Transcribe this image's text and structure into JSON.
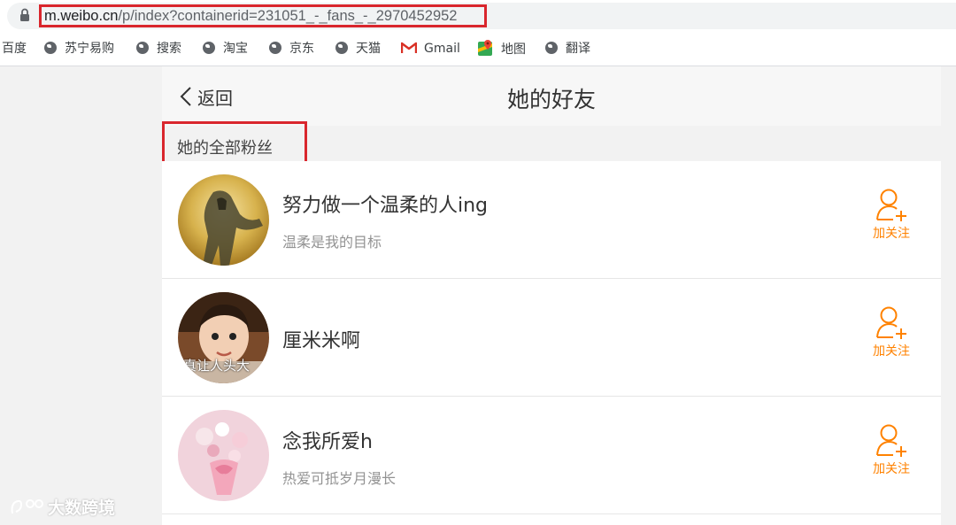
{
  "browser": {
    "url_host": "m.weibo.cn",
    "url_path": "/p/index?containerid=231051_-_fans_-_2970452952",
    "bookmarks": [
      {
        "label": "百度",
        "icon": "none"
      },
      {
        "label": "苏宁易购",
        "icon": "globe-icon"
      },
      {
        "label": "搜索",
        "icon": "globe-icon"
      },
      {
        "label": "淘宝",
        "icon": "globe-icon"
      },
      {
        "label": "京东",
        "icon": "globe-icon"
      },
      {
        "label": "天猫",
        "icon": "globe-icon"
      },
      {
        "label": "Gmail",
        "icon": "gmail-icon"
      },
      {
        "label": "地图",
        "icon": "maps-icon"
      },
      {
        "label": "翻译",
        "icon": "globe-icon"
      }
    ]
  },
  "nav": {
    "back_label": "返回",
    "title": "她的好友"
  },
  "section": {
    "label": "她的全部粉丝"
  },
  "fans": [
    {
      "name": "努力做一个温柔的人ing",
      "desc": "温柔是我的目标",
      "follow_label": "加关注",
      "avatar": "anime-figure-avatar"
    },
    {
      "name": "厘米米啊",
      "desc": "",
      "avatar_caption": "真让人头大",
      "follow_label": "加关注",
      "avatar": "baby-photo-avatar"
    },
    {
      "name": "念我所爱h",
      "desc": "热爱可抵岁月漫长",
      "follow_label": "加关注",
      "avatar": "flower-bouquet-avatar"
    }
  ],
  "watermark": {
    "text": "大数跨境"
  },
  "colors": {
    "accent_orange": "#ff8200",
    "highlight_red": "#d9262d"
  }
}
